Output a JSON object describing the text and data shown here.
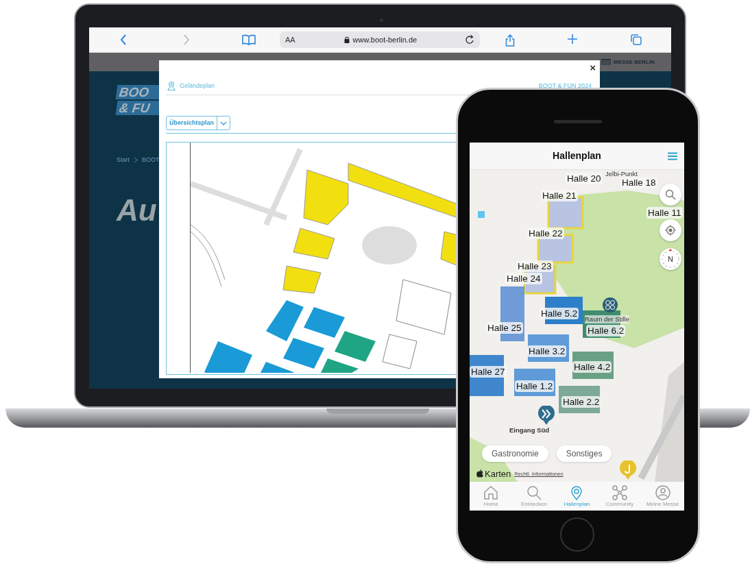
{
  "browser": {
    "text_size_button": "AA",
    "url": "www.boot-berlin.de"
  },
  "website": {
    "brand": "MESSE BERLIN",
    "logo_lines": [
      "BOO",
      "& FU"
    ],
    "breadcrumb": [
      "Start",
      "BOOT"
    ],
    "heading": "Au"
  },
  "modal": {
    "close": "×",
    "section": "Geländeplan",
    "event": "BOOT & FUN 2024",
    "view_select": {
      "value": "Übersichtsplan"
    }
  },
  "phone": {
    "title": "Hallenplan",
    "map_labels": [
      {
        "text": "Halle 20",
        "kind": "hall"
      },
      {
        "text": "Jelbi-Punkt",
        "kind": "poi"
      },
      {
        "text": "Halle 18",
        "kind": "hall"
      },
      {
        "text": "Halle 21",
        "kind": "hall"
      },
      {
        "text": "Halle 11",
        "kind": "hall"
      },
      {
        "text": "Halle 22",
        "kind": "hall"
      },
      {
        "text": "Halle 23",
        "kind": "hall"
      },
      {
        "text": "Halle 24",
        "kind": "hall"
      },
      {
        "text": "Halle 5.2",
        "kind": "hall"
      },
      {
        "text": "Raum der Stille",
        "kind": "poi"
      },
      {
        "text": "Halle 25",
        "kind": "hall"
      },
      {
        "text": "Halle 6.2",
        "kind": "hall"
      },
      {
        "text": "Halle 3.2",
        "kind": "hall"
      },
      {
        "text": "Halle 27",
        "kind": "hall"
      },
      {
        "text": "Halle 4.2",
        "kind": "hall"
      },
      {
        "text": "Halle 1.2",
        "kind": "hall"
      },
      {
        "text": "Halle 2.2",
        "kind": "hall"
      },
      {
        "text": "Eingang Süd",
        "kind": "entrance"
      }
    ],
    "compass_label": "N",
    "filters": [
      "Gastronomie",
      "Sonstiges"
    ],
    "attribution": {
      "brand": "Karten",
      "link": "Rechtl. Informationen"
    },
    "tabs": [
      {
        "label": "Home",
        "selected": false
      },
      {
        "label": "Entdecken",
        "selected": false
      },
      {
        "label": "Hallenplan",
        "selected": true
      },
      {
        "label": "Community",
        "selected": false
      },
      {
        "label": "Meine Messe",
        "selected": false
      }
    ]
  }
}
